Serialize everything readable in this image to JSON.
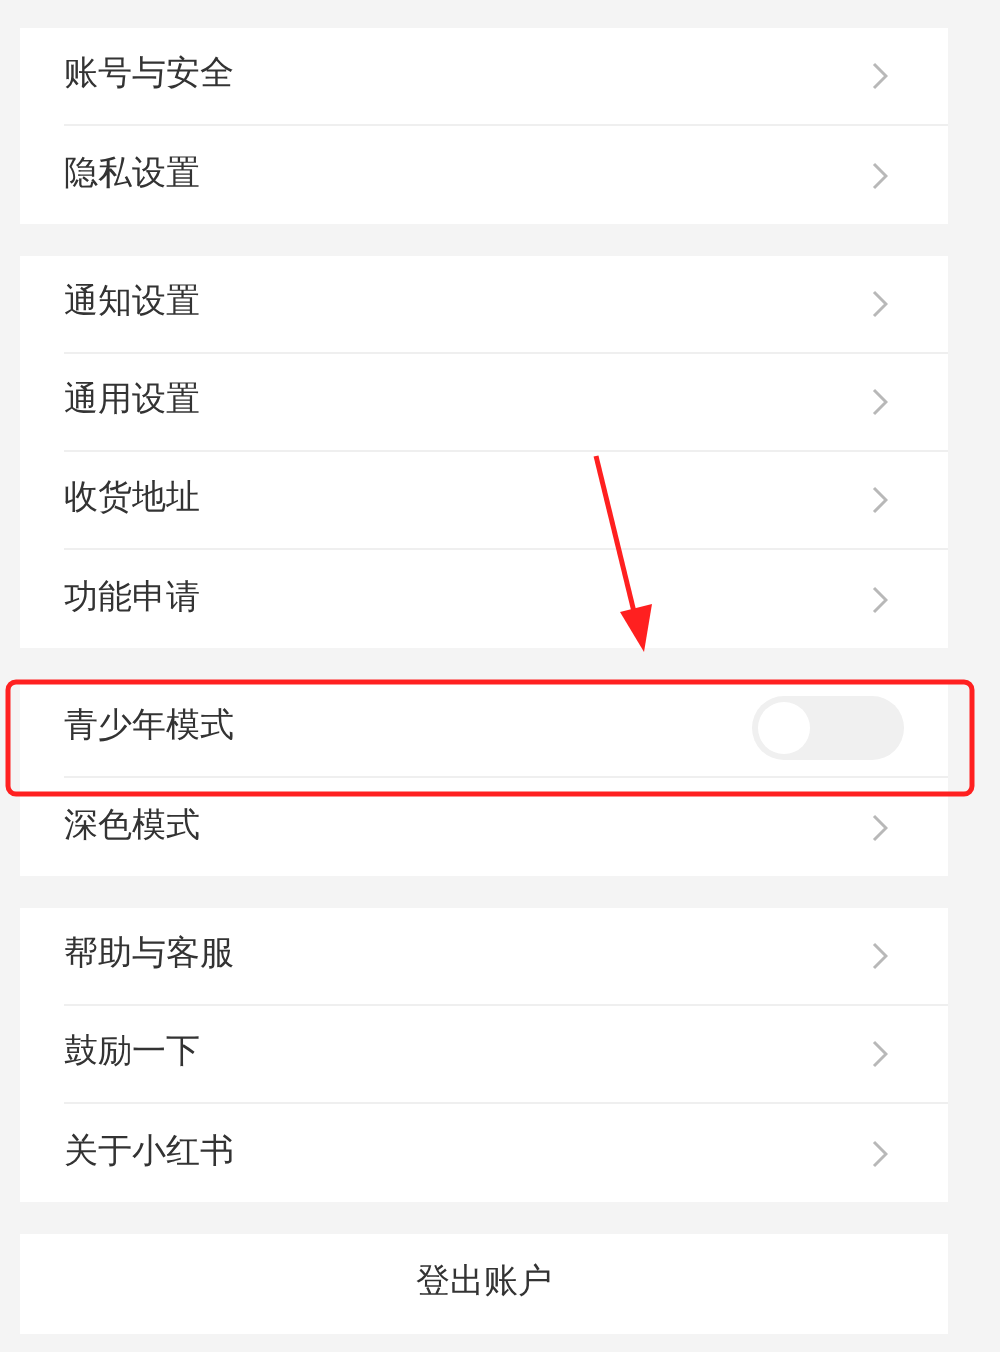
{
  "groups": [
    {
      "items": [
        {
          "label": "账号与安全",
          "kind": "link"
        },
        {
          "label": "隐私设置",
          "kind": "link"
        }
      ]
    },
    {
      "items": [
        {
          "label": "通知设置",
          "kind": "link"
        },
        {
          "label": "通用设置",
          "kind": "link"
        },
        {
          "label": "收货地址",
          "kind": "link"
        },
        {
          "label": "功能申请",
          "kind": "link"
        }
      ]
    },
    {
      "items": [
        {
          "label": "青少年模式",
          "kind": "toggle",
          "on": false
        },
        {
          "label": "深色模式",
          "kind": "link"
        }
      ]
    },
    {
      "items": [
        {
          "label": "帮助与客服",
          "kind": "link"
        },
        {
          "label": "鼓励一下",
          "kind": "link"
        },
        {
          "label": "关于小红书",
          "kind": "link"
        }
      ]
    }
  ],
  "logout_button": "登出账户"
}
